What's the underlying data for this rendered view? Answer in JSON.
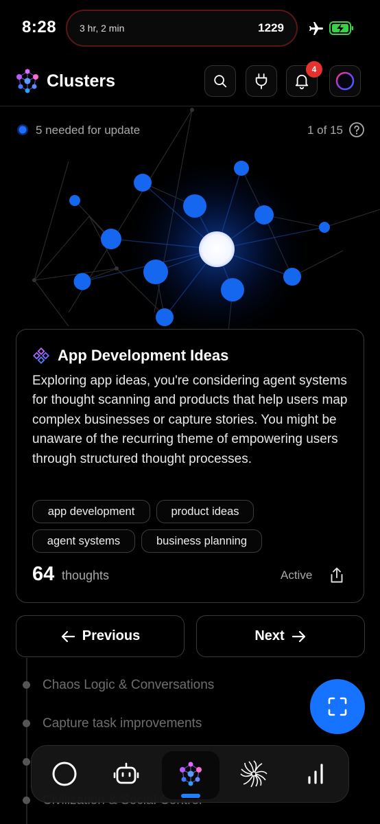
{
  "status_bar": {
    "time": "8:28",
    "island_left": "3 hr, 2 min",
    "island_right": "1229"
  },
  "header": {
    "title": "Clusters",
    "notification_count": "4"
  },
  "subheader": {
    "needed_text": "5 needed for update",
    "pager": "1 of 15"
  },
  "card": {
    "title": "App Development Ideas",
    "description": "Exploring app ideas, you're considering agent systems for thought scanning and products that help users map complex businesses or capture stories. You might be unaware of the recurring theme of empowering users through structured thought processes.",
    "tags": [
      "app development",
      "product ideas",
      "agent systems",
      "business planning"
    ],
    "thought_count": "64",
    "thought_label": "thoughts",
    "status": "Active"
  },
  "nav": {
    "previous_label": "Previous",
    "next_label": "Next"
  },
  "clusters_list": [
    "Chaos Logic & Conversations",
    "Capture task improvements",
    "",
    "Civilization & Social Control"
  ],
  "tabs": [
    "circle-icon",
    "robot-icon",
    "clusters-icon",
    "spiral-icon",
    "stats-icon"
  ],
  "colors": {
    "accent": "#1673ff",
    "badge": "#e5322d",
    "background": "#000000"
  }
}
